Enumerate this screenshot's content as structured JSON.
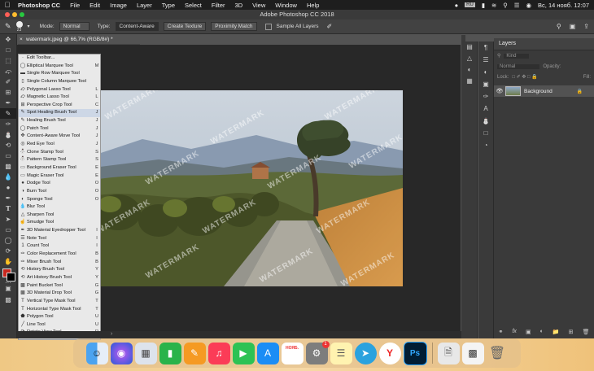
{
  "menubar": {
    "apple_icon": "apple-logo",
    "app_name": "Photoshop CC",
    "items": [
      "File",
      "Edit",
      "Image",
      "Layer",
      "Type",
      "Select",
      "Filter",
      "3D",
      "View",
      "Window",
      "Help"
    ],
    "keyboard_layout": "RU",
    "datetime": "Вс, 14 нояб.  12:07"
  },
  "window": {
    "title": "Adobe Photoshop CC 2018"
  },
  "options_bar": {
    "brush_size": "23",
    "mode_label": "Mode:",
    "mode_value": "Normal",
    "type_label": "Type:",
    "type_buttons": [
      "Content-Aware",
      "Create Texture",
      "Proximity Match"
    ],
    "sample_all_layers": "Sample All Layers"
  },
  "document": {
    "tab_label": "watermark.jpeg @ 66,7% (RGB/8#) *",
    "watermark_text": "WATERMARK"
  },
  "tool_flyout": {
    "items": [
      {
        "label": "Edit Toolbar...",
        "key": ""
      },
      {
        "label": "Elliptical Marquee Tool",
        "key": "M"
      },
      {
        "label": "Single Row Marquee Tool",
        "key": ""
      },
      {
        "label": "Single Column Marquee Tool",
        "key": ""
      },
      {
        "label": "Polygonal Lasso Tool",
        "key": "L"
      },
      {
        "label": "Magnetic Lasso Tool",
        "key": "L"
      },
      {
        "label": "Perspective Crop Tool",
        "key": "C"
      },
      {
        "label": "Spot Healing Brush Tool",
        "key": "J"
      },
      {
        "label": "Healing Brush Tool",
        "key": "J"
      },
      {
        "label": "Patch Tool",
        "key": "J"
      },
      {
        "label": "Content-Aware Move Tool",
        "key": "J"
      },
      {
        "label": "Red Eye Tool",
        "key": "J"
      },
      {
        "label": "Clone Stamp Tool",
        "key": "S"
      },
      {
        "label": "Pattern Stamp Tool",
        "key": "S"
      },
      {
        "label": "Background Eraser Tool",
        "key": "E"
      },
      {
        "label": "Magic Eraser Tool",
        "key": "E"
      },
      {
        "label": "Dodge Tool",
        "key": "O"
      },
      {
        "label": "Burn Tool",
        "key": "O"
      },
      {
        "label": "Sponge Tool",
        "key": "O"
      },
      {
        "label": "Blur Tool",
        "key": ""
      },
      {
        "label": "Sharpen Tool",
        "key": ""
      },
      {
        "label": "Smudge Tool",
        "key": ""
      },
      {
        "label": "3D Material Eyedropper Tool",
        "key": "I"
      },
      {
        "label": "Note Tool",
        "key": "I"
      },
      {
        "label": "Count Tool",
        "key": "I"
      },
      {
        "label": "Color Replacement Tool",
        "key": "B"
      },
      {
        "label": "Mixer Brush Tool",
        "key": "B"
      },
      {
        "label": "History Brush Tool",
        "key": "Y"
      },
      {
        "label": "Art History Brush Tool",
        "key": "Y"
      },
      {
        "label": "Paint Bucket Tool",
        "key": "G"
      },
      {
        "label": "3D Material Drop Tool",
        "key": "G"
      },
      {
        "label": "Vertical Type Mask Tool",
        "key": "T"
      },
      {
        "label": "Horizontal Type Mask Tool",
        "key": "T"
      },
      {
        "label": "Polygon Tool",
        "key": "U"
      },
      {
        "label": "Line Tool",
        "key": "U"
      },
      {
        "label": "Rotate View Tool",
        "key": "R"
      }
    ],
    "selected_index": 7
  },
  "layers_panel": {
    "title": "Layers",
    "filter_label": "Kind",
    "blend_mode": "Normal",
    "opacity_label": "Opacity:",
    "lock_label": "Lock:",
    "fill_label": "Fill:",
    "layer_name": "Background"
  },
  "dock": {
    "calendar_month": "НОЯБ.",
    "calendar_day": "14",
    "settings_badge": "1",
    "ps_label": "Ps"
  },
  "colors": {
    "foreground": "#c8271e",
    "background": "#000000",
    "accent_selection": "#cdd7e6"
  }
}
